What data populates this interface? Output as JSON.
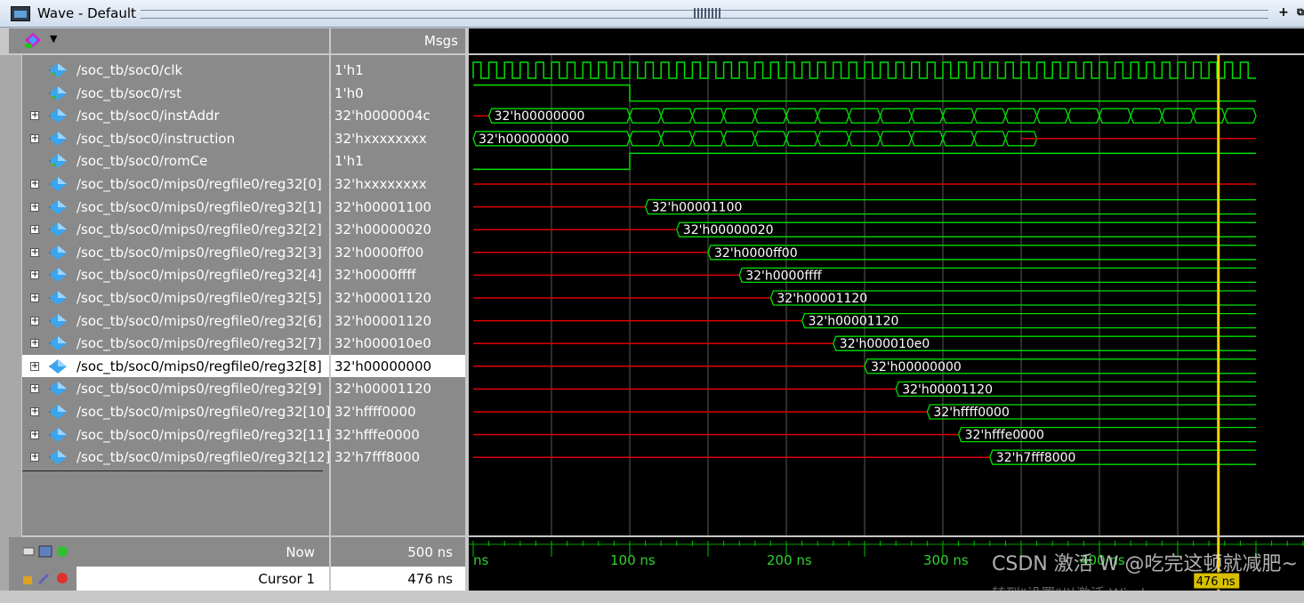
{
  "window": {
    "title": "Wave - Default"
  },
  "header": {
    "msgs_label": "Msgs"
  },
  "signals": [
    {
      "name": "/soc_tb/soc0/clk",
      "value": "1'h1",
      "expandable": false,
      "kind": "clock"
    },
    {
      "name": "/soc_tb/soc0/rst",
      "value": "1'h0",
      "expandable": false,
      "kind": "bit",
      "edges": [
        0,
        100
      ],
      "levels": [
        1,
        0
      ]
    },
    {
      "name": "/soc_tb/soc0/instAddr",
      "value": "32'h0000004c",
      "expandable": true,
      "kind": "bus",
      "first_label": "32'h00000000",
      "first_change": 10
    },
    {
      "name": "/soc_tb/soc0/instruction",
      "value": "32'hxxxxxxxx",
      "expandable": true,
      "kind": "bus_x",
      "first_label": "32'h00000000"
    },
    {
      "name": "/soc_tb/soc0/romCe",
      "value": "1'h1",
      "expandable": false,
      "kind": "bit",
      "edges": [
        0,
        100
      ],
      "levels": [
        0,
        1
      ]
    },
    {
      "name": "/soc_tb/soc0/mips0/regfile0/reg32[0]",
      "value": "32'hxxxxxxxx",
      "expandable": true,
      "kind": "xonly"
    },
    {
      "name": "/soc_tb/soc0/mips0/regfile0/reg32[1]",
      "value": "32'h00001100",
      "expandable": true,
      "kind": "reg",
      "change": 110,
      "label": "32'h00001100"
    },
    {
      "name": "/soc_tb/soc0/mips0/regfile0/reg32[2]",
      "value": "32'h00000020",
      "expandable": true,
      "kind": "reg",
      "change": 130,
      "label": "32'h00000020"
    },
    {
      "name": "/soc_tb/soc0/mips0/regfile0/reg32[3]",
      "value": "32'h0000ff00",
      "expandable": true,
      "kind": "reg",
      "change": 150,
      "label": "32'h0000ff00"
    },
    {
      "name": "/soc_tb/soc0/mips0/regfile0/reg32[4]",
      "value": "32'h0000ffff",
      "expandable": true,
      "kind": "reg",
      "change": 170,
      "label": "32'h0000ffff"
    },
    {
      "name": "/soc_tb/soc0/mips0/regfile0/reg32[5]",
      "value": "32'h00001120",
      "expandable": true,
      "kind": "reg",
      "change": 190,
      "label": "32'h00001120"
    },
    {
      "name": "/soc_tb/soc0/mips0/regfile0/reg32[6]",
      "value": "32'h00001120",
      "expandable": true,
      "kind": "reg",
      "change": 210,
      "label": "32'h00001120"
    },
    {
      "name": "/soc_tb/soc0/mips0/regfile0/reg32[7]",
      "value": "32'h000010e0",
      "expandable": true,
      "kind": "reg",
      "change": 230,
      "label": "32'h000010e0"
    },
    {
      "name": "/soc_tb/soc0/mips0/regfile0/reg32[8]",
      "value": "32'h00000000",
      "expandable": true,
      "kind": "reg",
      "change": 250,
      "label": "32'h00000000",
      "selected": true
    },
    {
      "name": "/soc_tb/soc0/mips0/regfile0/reg32[9]",
      "value": "32'h00001120",
      "expandable": true,
      "kind": "reg",
      "change": 270,
      "label": "32'h00001120"
    },
    {
      "name": "/soc_tb/soc0/mips0/regfile0/reg32[10]",
      "value": "32'hffff0000",
      "expandable": true,
      "kind": "reg",
      "change": 290,
      "label": "32'hffff0000"
    },
    {
      "name": "/soc_tb/soc0/mips0/regfile0/reg32[11]",
      "value": "32'hfffe0000",
      "expandable": true,
      "kind": "reg",
      "change": 310,
      "label": "32'hfffe0000"
    },
    {
      "name": "/soc_tb/soc0/mips0/regfile0/reg32[12]",
      "value": "32'h7fff8000",
      "expandable": true,
      "kind": "reg",
      "change": 330,
      "label": "32'h7fff8000"
    }
  ],
  "time": {
    "unit": "ns",
    "visible_start": 0,
    "visible_end": 530,
    "clock_period": 10,
    "instruction_x_from": 350
  },
  "timeline": {
    "ticks": [
      "ns",
      "100 ns",
      "200 ns",
      "300 ns",
      "400 ns"
    ],
    "tick_values": [
      0,
      100,
      200,
      300,
      400
    ]
  },
  "status": {
    "now_label": "Now",
    "now_value": "500 ns",
    "cursor_label": "Cursor 1",
    "cursor_value": "476 ns",
    "cursor_time": 476,
    "cursor_tag": "476 ns"
  },
  "colors": {
    "wave": "#00e000",
    "undefined": "#e00000",
    "cursor": "#ffd000",
    "grid": "#5a5a5a"
  },
  "watermark": {
    "text": "激活 W @吃完这顿就减肥~",
    "csdn": "CSDN",
    "sub": "转到\"设置\"以激活 Windows"
  }
}
